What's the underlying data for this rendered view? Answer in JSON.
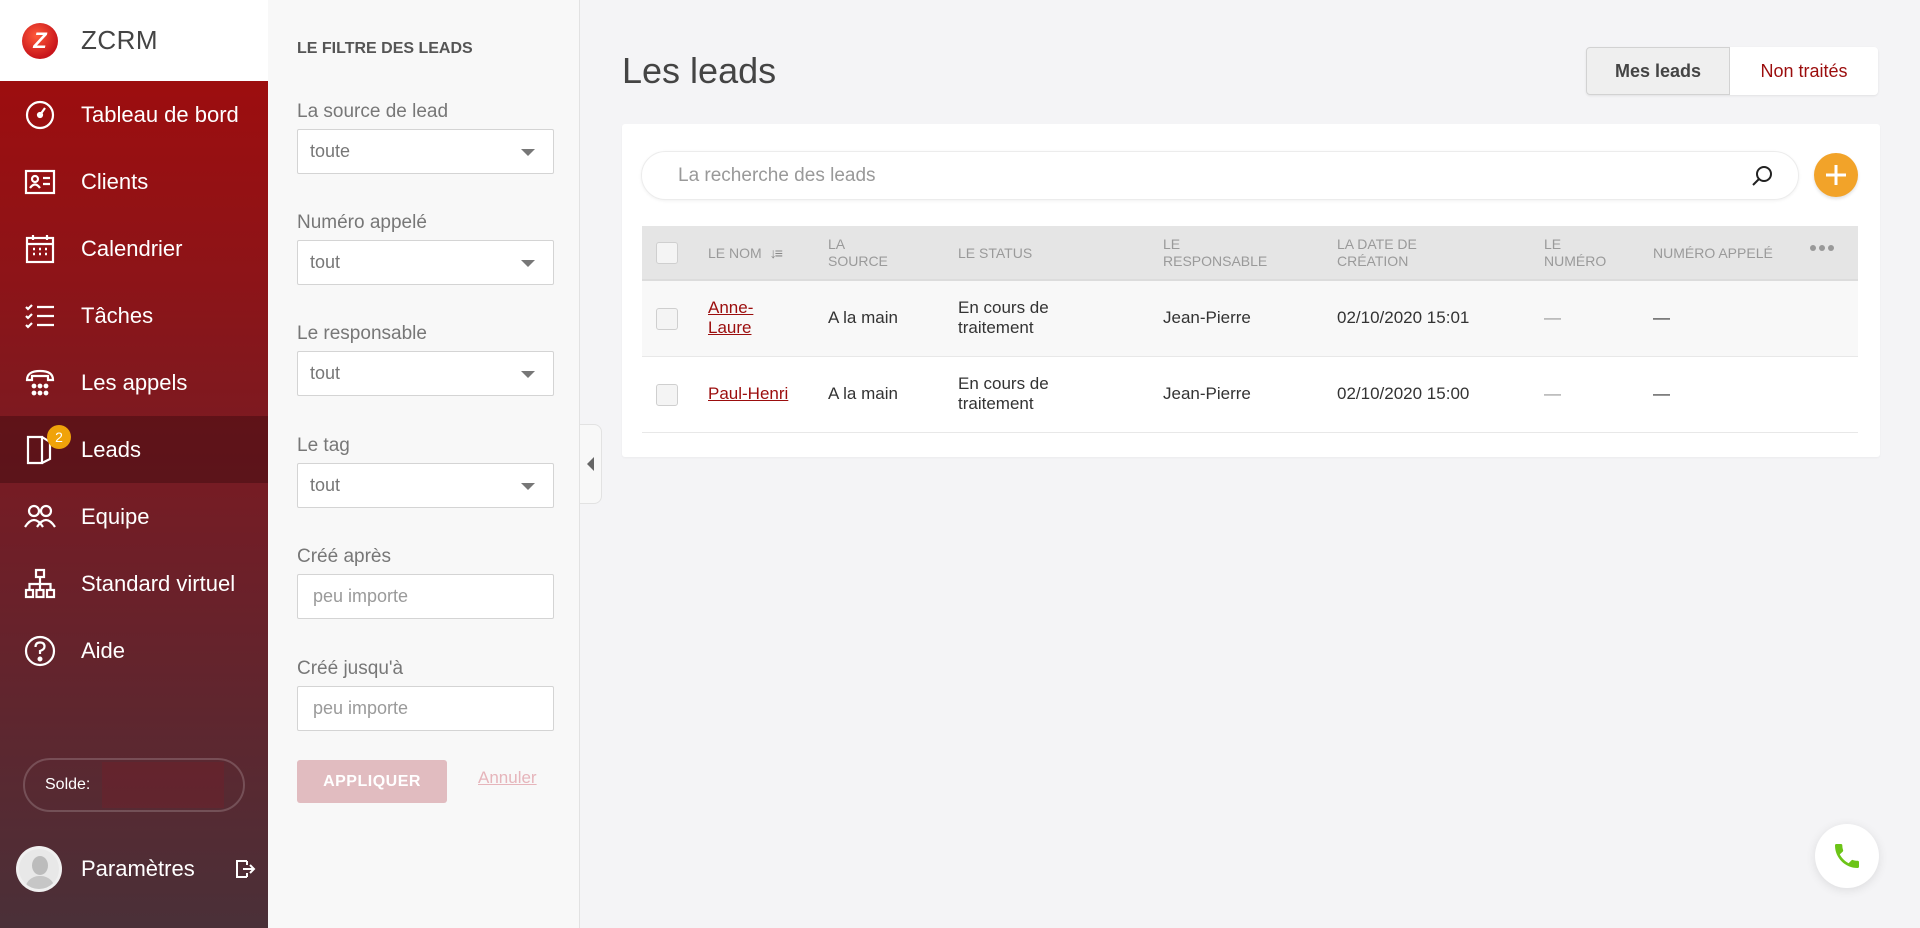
{
  "app": {
    "name": "ZCRM"
  },
  "sidebar": {
    "items": [
      {
        "label": "Tableau de bord",
        "icon": "dashboard-icon"
      },
      {
        "label": "Clients",
        "icon": "contact-card-icon"
      },
      {
        "label": "Calendrier",
        "icon": "calendar-icon"
      },
      {
        "label": "Tâches",
        "icon": "tasks-icon"
      },
      {
        "label": "Les appels",
        "icon": "phone-dialpad-icon"
      },
      {
        "label": "Leads",
        "icon": "leads-icon",
        "badge": "2",
        "active": true
      },
      {
        "label": "Equipe",
        "icon": "team-icon"
      },
      {
        "label": "Standard virtuel",
        "icon": "org-chart-icon"
      },
      {
        "label": "Aide",
        "icon": "help-icon"
      }
    ],
    "balance_label": "Solde:",
    "balance_value": "",
    "settings_label": "Paramètres"
  },
  "filters": {
    "title": "LE FILTRE DES LEADS",
    "lead_source": {
      "label": "La source de lead",
      "value": "toute"
    },
    "called_number": {
      "label": "Numéro appelé",
      "value": "tout"
    },
    "owner": {
      "label": "Le responsable",
      "value": "tout"
    },
    "tag": {
      "label": "Le tag",
      "value": "tout"
    },
    "created_after": {
      "label": "Créé après",
      "placeholder": "peu importe"
    },
    "created_until": {
      "label": "Créé jusqu'à",
      "placeholder": "peu importe"
    },
    "apply_label": "APPLIQUER",
    "cancel_label": "Annuler"
  },
  "main": {
    "title": "Les leads",
    "segments": {
      "mine": "Mes leads",
      "untreated": "Non traités"
    },
    "search": {
      "placeholder": "La recherche des leads",
      "value": ""
    },
    "table": {
      "columns": [
        "LE NOM",
        "LA SOURCE",
        "LE STATUS",
        "LE RESPONSABLE",
        "LA DATE DE CRÉATION",
        "LE NUMÉRO",
        "NUMÉRO APPELÉ"
      ],
      "rows": [
        {
          "name": "Anne-Laure",
          "source": "A la main",
          "status": "En cours de traitement",
          "owner": "Jean-Pierre",
          "created": "02/10/2020 15:01",
          "number": "—",
          "called": "—"
        },
        {
          "name": "Paul-Henri",
          "source": "A la main",
          "status": "En cours de traitement",
          "owner": "Jean-Pierre",
          "created": "02/10/2020 15:00",
          "number": "—",
          "called": "—"
        }
      ]
    }
  },
  "colors": {
    "brand": "#9b0d0d",
    "accent": "#f2a329",
    "call": "#6cc417"
  }
}
